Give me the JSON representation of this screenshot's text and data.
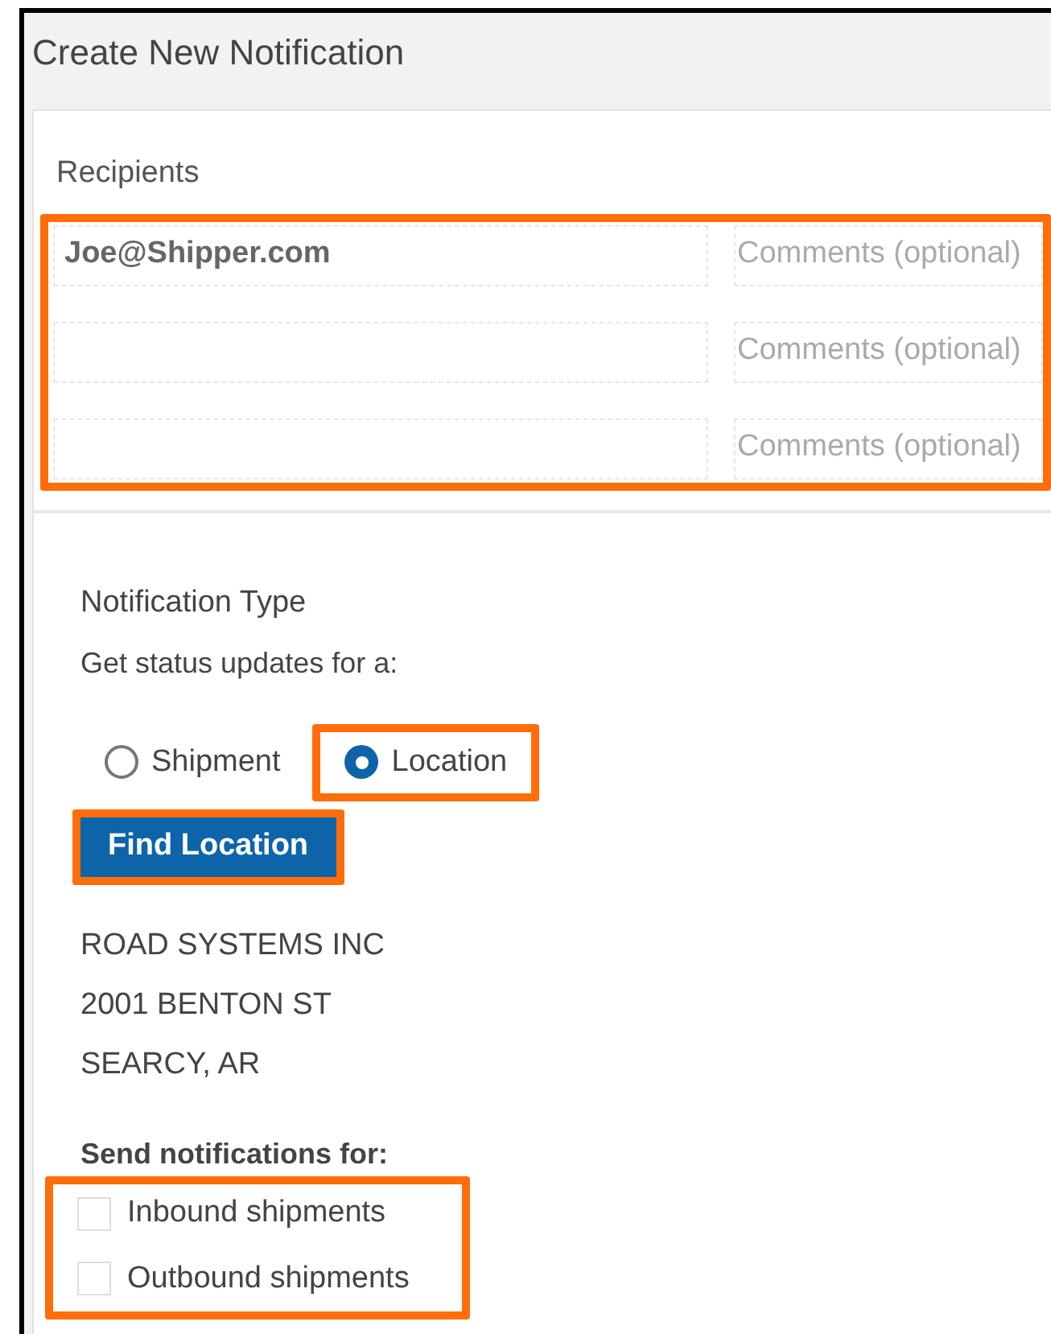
{
  "window": {
    "title": "Create New Notification"
  },
  "recipients": {
    "title": "Recipients",
    "highlighted": true,
    "rows": [
      {
        "email": "Joe@Shipper.com",
        "comment_placeholder": "Comments (optional)"
      },
      {
        "comment_placeholder": "Comments (optional)"
      },
      {
        "comment_placeholder": "Comments (optional)"
      }
    ]
  },
  "notification_type": {
    "title": "Notification Type",
    "prompt": "Get status updates for a:",
    "options": [
      {
        "label": "Shipment",
        "selected": false,
        "highlighted": false
      },
      {
        "label": "Location",
        "selected": true,
        "highlighted": true
      }
    ]
  },
  "find_button": {
    "label": "Find Location",
    "highlighted": true
  },
  "address": [
    "ROAD SYSTEMS INC",
    "2001 BENTON ST",
    "SEARCY, AR"
  ],
  "send_for": {
    "title": "Send notifications for:",
    "highlighted": true,
    "options": [
      {
        "label": "Inbound shipments",
        "checked": false
      },
      {
        "label": "Outbound shipments",
        "checked": false
      }
    ]
  }
}
